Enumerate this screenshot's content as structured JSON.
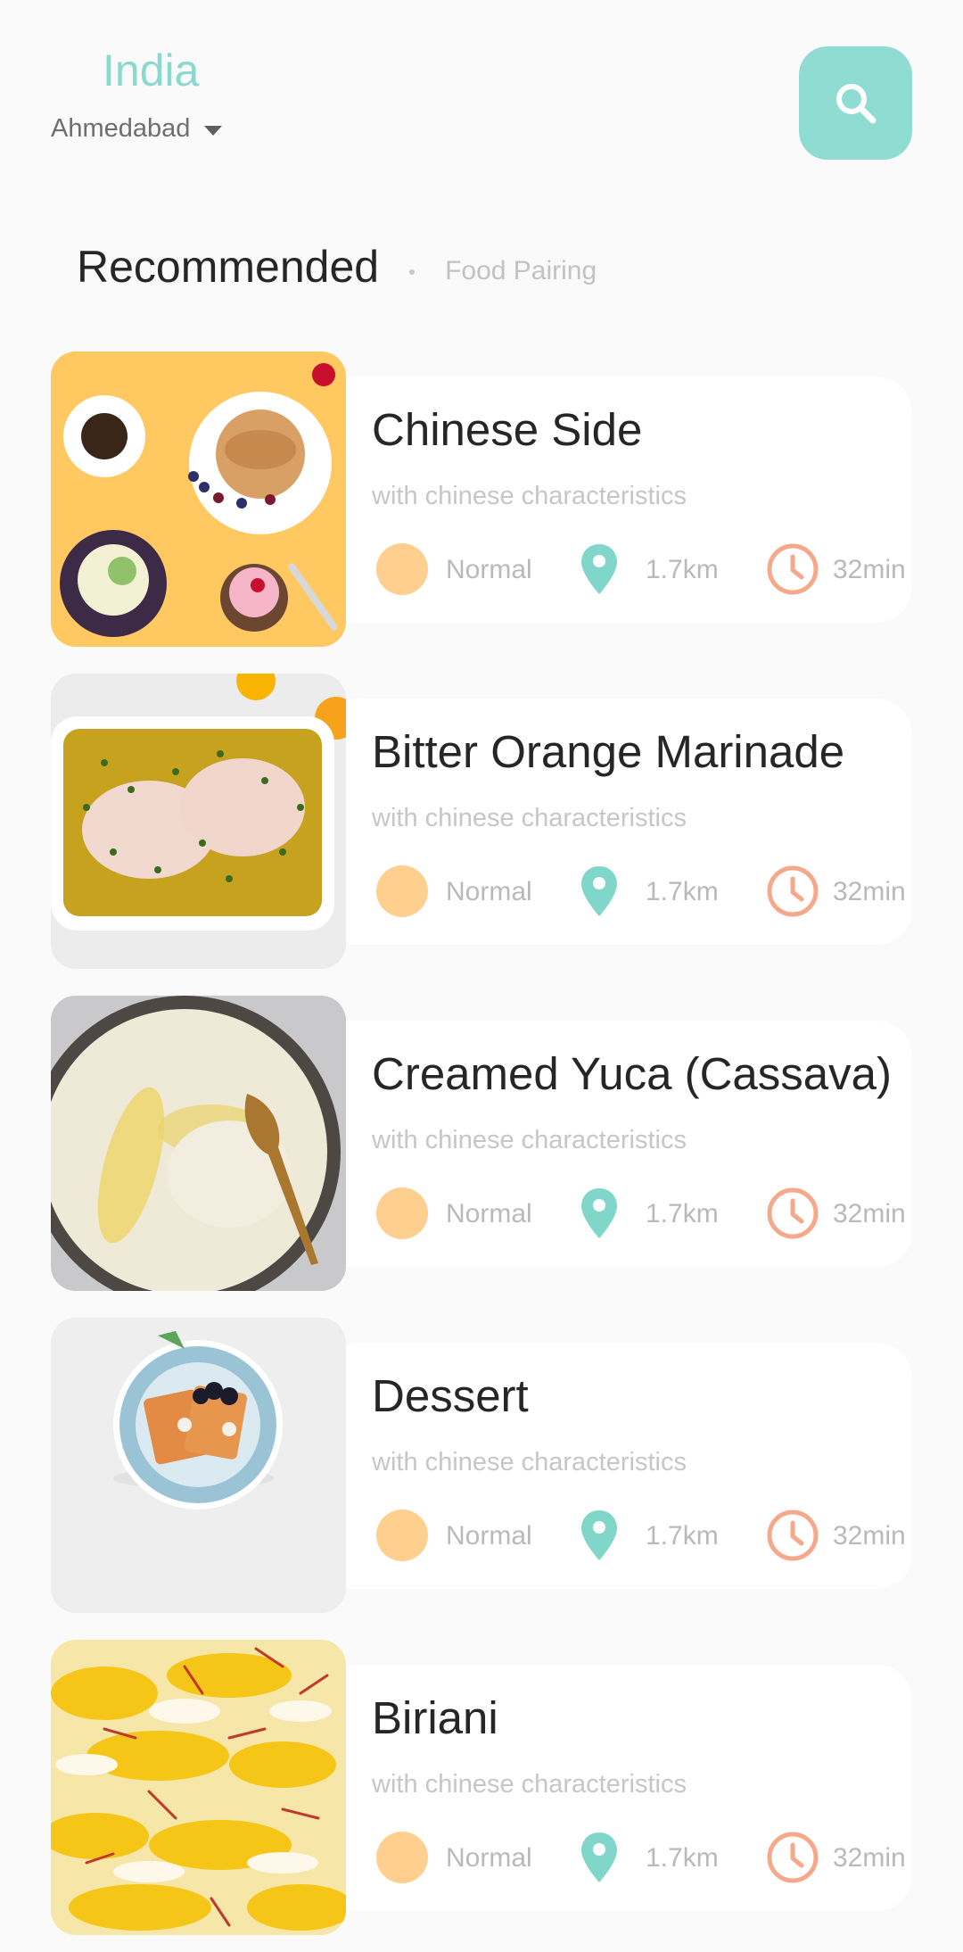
{
  "location": {
    "country": "India",
    "city": "Ahmedabad"
  },
  "header": {
    "search_icon": "search-icon",
    "dropdown_icon": "caret-down-icon"
  },
  "section": {
    "title": "Recommended",
    "subtitle": "Food Pairing"
  },
  "colors": {
    "accent": "#8fdcd2",
    "level": "#ffcf8f",
    "pin": "#7fd6c9",
    "clock": "#f6a88a"
  },
  "items": [
    {
      "name": "Chinese Side",
      "tag": "with chinese characteristics",
      "level": "Normal",
      "distance": "1.7km",
      "time": "32min",
      "image": "pancake-cupcakes-photo"
    },
    {
      "name": "Bitter Orange Marinade",
      "tag": "with chinese characteristics",
      "level": "Normal",
      "distance": "1.7km",
      "time": "32min",
      "image": "chicken-marinade-photo"
    },
    {
      "name": "Creamed Yuca (Cassava)",
      "tag": "with chinese characteristics",
      "level": "Normal",
      "distance": "1.7km",
      "time": "32min",
      "image": "mashed-yuca-photo"
    },
    {
      "name": "Dessert",
      "tag": "with chinese characteristics",
      "level": "Normal",
      "distance": "1.7km",
      "time": "32min",
      "image": "waffle-dessert-photo"
    },
    {
      "name": "Biriani",
      "tag": "with chinese characteristics",
      "level": "Normal",
      "distance": "1.7km",
      "time": "32min",
      "image": "saffron-rice-photo"
    }
  ]
}
